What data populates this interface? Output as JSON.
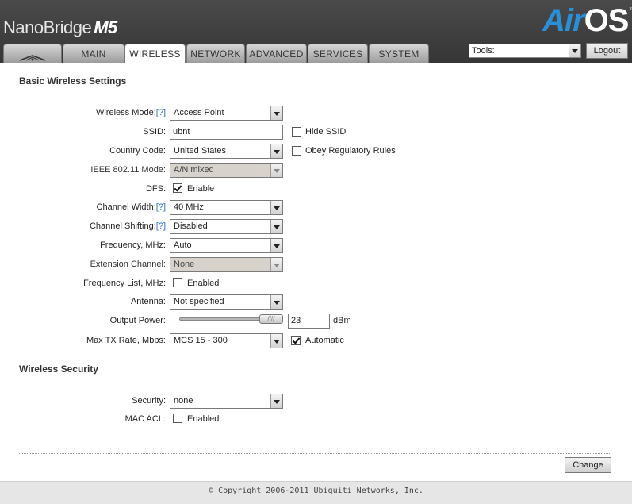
{
  "header": {
    "product_name": "NanoBridge",
    "product_model": "M5",
    "brand_air": "Air",
    "brand_os": "OS",
    "brand_tm": "™"
  },
  "tabs": [
    {
      "label": "",
      "icon": "ubiquiti-logo-icon",
      "active": false
    },
    {
      "label": "MAIN",
      "active": false
    },
    {
      "label": "WIRELESS",
      "active": true
    },
    {
      "label": "NETWORK",
      "active": false
    },
    {
      "label": "ADVANCED",
      "active": false
    },
    {
      "label": "SERVICES",
      "active": false
    },
    {
      "label": "SYSTEM",
      "active": false
    }
  ],
  "tools": {
    "selected": "Tools:",
    "logout_label": "Logout"
  },
  "basic": {
    "title": "Basic Wireless Settings",
    "help": "[?]",
    "wireless_mode": {
      "label": "Wireless Mode:",
      "value": "Access Point"
    },
    "ssid": {
      "label": "SSID:",
      "value": "ubnt",
      "hide_label": "Hide SSID",
      "hide_checked": false
    },
    "country": {
      "label": "Country Code:",
      "value": "United States",
      "obey_label": "Obey Regulatory Rules",
      "obey_checked": false
    },
    "ieee": {
      "label": "IEEE 802.11 Mode:",
      "value": "A/N mixed"
    },
    "dfs": {
      "label": "DFS:",
      "checkbox_label": "Enable",
      "checked": true
    },
    "channel_width": {
      "label": "Channel Width:",
      "value": "40 MHz"
    },
    "channel_shifting": {
      "label": "Channel Shifting:",
      "value": "Disabled"
    },
    "frequency": {
      "label": "Frequency, MHz:",
      "value": "Auto"
    },
    "extension": {
      "label": "Extension Channel:",
      "value": "None"
    },
    "freq_list": {
      "label": "Frequency List, MHz:",
      "checkbox_label": "Enabled",
      "checked": false
    },
    "antenna": {
      "label": "Antenna:",
      "value": "Not specified"
    },
    "output_power": {
      "label": "Output Power:",
      "value": "23",
      "unit": "dBm",
      "slider_level": 0.85
    },
    "max_tx": {
      "label": "Max TX Rate, Mbps:",
      "value": "MCS 15 - 300",
      "auto_label": "Automatic",
      "auto_checked": true
    }
  },
  "security": {
    "title": "Wireless Security",
    "security": {
      "label": "Security:",
      "value": "none"
    },
    "mac_acl": {
      "label": "MAC ACL:",
      "checkbox_label": "Enabled",
      "checked": false
    }
  },
  "actions": {
    "change_label": "Change"
  },
  "footer": {
    "copyright": "© Copyright 2006-2011 Ubiquiti Networks, Inc."
  }
}
